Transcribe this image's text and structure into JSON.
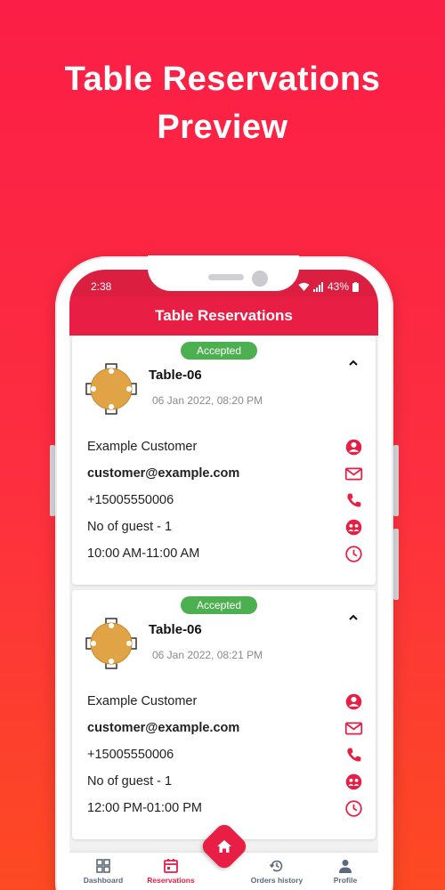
{
  "promo": {
    "line1": "Table Reservations",
    "line2": "Preview"
  },
  "status_bar": {
    "time": "2:38",
    "battery": "43%"
  },
  "app_bar": {
    "title": "Table Reservations"
  },
  "reservations": [
    {
      "status": "Accepted",
      "table": "Table-06",
      "date": "06 Jan 2022, 08:20 PM",
      "customer": "Example Customer",
      "email": "customer@example.com",
      "phone": "+15005550006",
      "guests": "No of guest  -  1",
      "time_slot": "10:00 AM-11:00 AM"
    },
    {
      "status": "Accepted",
      "table": "Table-06",
      "date": "06 Jan 2022, 08:21 PM",
      "customer": "Example Customer",
      "email": "customer@example.com",
      "phone": "+15005550006",
      "guests": "No of guest  -  1",
      "time_slot": "12:00 PM-01:00 PM"
    }
  ],
  "bottom_nav": [
    {
      "label": "Dashboard",
      "icon": "dashboard-icon",
      "active": false
    },
    {
      "label": "Reservations",
      "icon": "calendar-icon",
      "active": true
    },
    {
      "label": "Orders history",
      "icon": "history-icon",
      "active": false
    },
    {
      "label": "Profile",
      "icon": "person-icon",
      "active": false
    }
  ],
  "colors": {
    "accent": "#e81e44",
    "badge": "#4caf50",
    "background_top": "#fb1e46",
    "background_bottom": "#fd4a22"
  }
}
